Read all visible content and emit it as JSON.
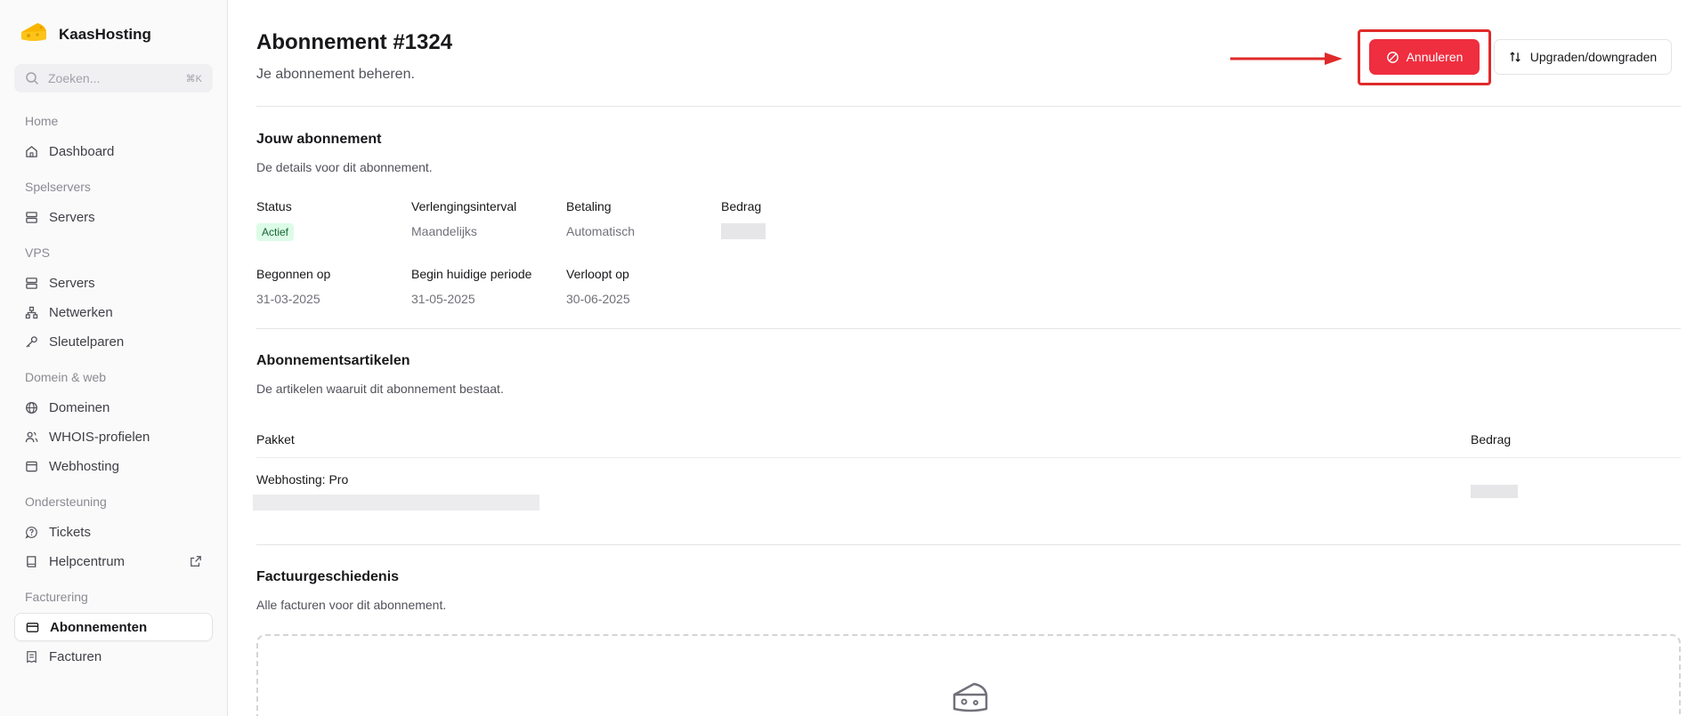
{
  "brand": {
    "name": "KaasHosting",
    "logo_icon": "cheese-icon"
  },
  "search": {
    "placeholder": "Zoeken...",
    "shortcut": "⌘K"
  },
  "nav": {
    "sections": [
      {
        "title": "Home",
        "items": [
          {
            "label": "Dashboard",
            "icon": "home-icon"
          }
        ]
      },
      {
        "title": "Spelservers",
        "items": [
          {
            "label": "Servers",
            "icon": "server-icon"
          }
        ]
      },
      {
        "title": "VPS",
        "items": [
          {
            "label": "Servers",
            "icon": "server-icon"
          },
          {
            "label": "Netwerken",
            "icon": "network-icon"
          },
          {
            "label": "Sleutelparen",
            "icon": "key-icon"
          }
        ]
      },
      {
        "title": "Domein & web",
        "items": [
          {
            "label": "Domeinen",
            "icon": "globe-icon"
          },
          {
            "label": "WHOIS-profielen",
            "icon": "users-icon"
          },
          {
            "label": "Webhosting",
            "icon": "browser-icon"
          }
        ]
      },
      {
        "title": "Ondersteuning",
        "items": [
          {
            "label": "Tickets",
            "icon": "help-bubble-icon"
          },
          {
            "label": "Helpcentrum",
            "icon": "book-icon",
            "external_icon": "external-link-icon"
          }
        ]
      },
      {
        "title": "Facturering",
        "items": [
          {
            "label": "Abonnementen",
            "icon": "credit-card-icon",
            "active": true
          },
          {
            "label": "Facturen",
            "icon": "receipt-icon"
          }
        ]
      }
    ]
  },
  "header": {
    "title": "Abonnement #1324",
    "subtitle": "Je abonnement beheren.",
    "cancel_label": "Annuleren",
    "upgrade_label": "Upgraden/downgraden"
  },
  "subscription": {
    "title": "Jouw abonnement",
    "subtitle": "De details voor dit abonnement.",
    "status_label": "Status",
    "status_value": "Actief",
    "interval_label": "Verlengingsinterval",
    "interval_value": "Maandelijks",
    "payment_label": "Betaling",
    "payment_value": "Automatisch",
    "amount_label": "Bedrag",
    "started_label": "Begonnen op",
    "started_value": "31-03-2025",
    "period_label": "Begin huidige periode",
    "period_value": "31-05-2025",
    "expires_label": "Verloopt op",
    "expires_value": "30-06-2025"
  },
  "items": {
    "title": "Abonnementsartikelen",
    "subtitle": "De artikelen waaruit dit abonnement bestaat.",
    "col_package": "Pakket",
    "col_amount": "Bedrag",
    "rows": [
      {
        "name": "Webhosting: Pro"
      }
    ]
  },
  "invoices": {
    "title": "Factuurgeschiedenis",
    "subtitle": "Alle facturen voor dit abonnement.",
    "empty_icon": "cheese-icon"
  },
  "colors": {
    "accent_red": "#ef2e3f",
    "highlight": "#e02a2a",
    "status_green": "#dcfce7"
  }
}
